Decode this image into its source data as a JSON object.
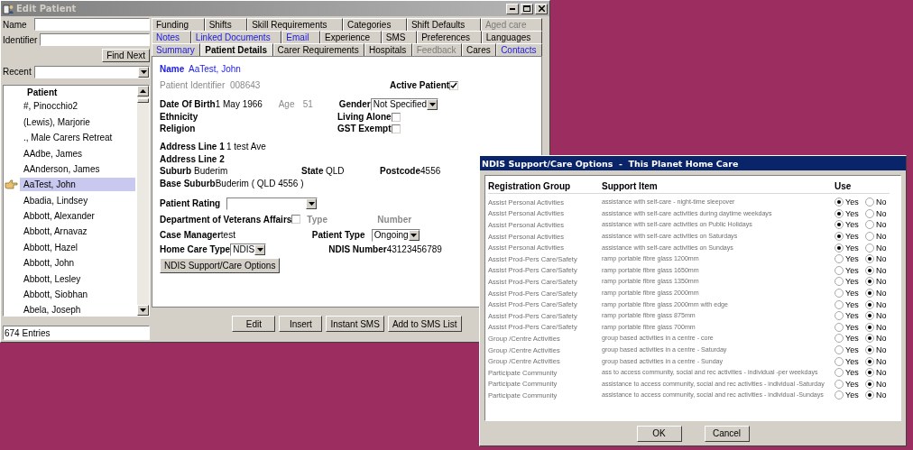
{
  "main_window": {
    "title": "Edit Patient"
  },
  "search": {
    "name_label": "Name",
    "identifier_label": "Identifier",
    "find_button": "Find Next",
    "recent_label": "Recent"
  },
  "patients": {
    "header": "Patient",
    "items": [
      {
        "name": "#, Pinocchio2",
        "selected": false
      },
      {
        "name": "(Lewis), Marjorie",
        "selected": false
      },
      {
        "name": "., Male Carers Retreat",
        "selected": false
      },
      {
        "name": "AAdbe, James",
        "selected": false
      },
      {
        "name": "AAnderson, James",
        "selected": false
      },
      {
        "name": "AaTest, John",
        "selected": true
      },
      {
        "name": "Abadia, Lindsey",
        "selected": false
      },
      {
        "name": "Abbott, Alexander",
        "selected": false
      },
      {
        "name": "Abbott, Arnavaz",
        "selected": false
      },
      {
        "name": "Abbott, Hazel",
        "selected": false
      },
      {
        "name": "Abbott, John",
        "selected": false
      },
      {
        "name": "Abbott, Lesley",
        "selected": false
      },
      {
        "name": "Abbott, Siobhan",
        "selected": false
      },
      {
        "name": "Abela, Joseph",
        "selected": false
      }
    ],
    "entries": "674 Entries"
  },
  "tab_rows": [
    {
      "tabs": [
        {
          "label": "Funding",
          "selected": false,
          "disabled": false,
          "highlighted": false
        },
        {
          "label": "Shifts",
          "selected": false,
          "disabled": false,
          "highlighted": false
        },
        {
          "label": "Skill Requirements",
          "selected": false,
          "disabled": false,
          "highlighted": false
        },
        {
          "label": "Categories",
          "selected": false,
          "disabled": false,
          "highlighted": false
        },
        {
          "label": "Shift Defaults",
          "selected": false,
          "disabled": false,
          "highlighted": false
        },
        {
          "label": "Aged care",
          "selected": false,
          "disabled": true,
          "highlighted": false
        }
      ]
    },
    {
      "tabs": [
        {
          "label": "Notes",
          "selected": false,
          "disabled": false,
          "highlighted": true
        },
        {
          "label": "Linked Documents",
          "selected": false,
          "disabled": false,
          "highlighted": true
        },
        {
          "label": "Email",
          "selected": false,
          "disabled": false,
          "highlighted": true
        },
        {
          "label": "Experience",
          "selected": false,
          "disabled": false,
          "highlighted": false
        },
        {
          "label": "SMS",
          "selected": false,
          "disabled": false,
          "highlighted": false
        },
        {
          "label": "Preferences",
          "selected": false,
          "disabled": false,
          "highlighted": false
        },
        {
          "label": "Languages",
          "selected": false,
          "disabled": false,
          "highlighted": false
        }
      ]
    },
    {
      "tabs": [
        {
          "label": "Summary",
          "selected": false,
          "disabled": false,
          "highlighted": true
        },
        {
          "label": "Patient Details",
          "selected": true,
          "disabled": false,
          "highlighted": false
        },
        {
          "label": "Carer Requirements",
          "selected": false,
          "disabled": false,
          "highlighted": false
        },
        {
          "label": "Hospitals",
          "selected": false,
          "disabled": false,
          "highlighted": false
        },
        {
          "label": "Feedback",
          "selected": false,
          "disabled": true,
          "highlighted": false
        },
        {
          "label": "Cares",
          "selected": false,
          "disabled": false,
          "highlighted": false
        },
        {
          "label": "Contacts",
          "selected": false,
          "disabled": false,
          "highlighted": true
        }
      ]
    }
  ],
  "details": {
    "name_label": "Name",
    "name": "AaTest, John",
    "identifier_label": "Patient Identifier",
    "identifier": "008643",
    "active_label": "Active Patient",
    "active": true,
    "dob_label": "Date Of Birth",
    "dob": "1 May 1966",
    "age_label": "Age",
    "age": "51",
    "gender_label": "Gender",
    "gender": "Not Specified",
    "ethnicity_label": "Ethnicity",
    "living_alone_label": "Living Alone",
    "living_alone": false,
    "religion_label": "Religion",
    "gst_label": "GST Exempt",
    "gst_exempt": false,
    "address1_label": "Address Line 1",
    "address1": "1 test Ave",
    "address2_label": "Address Line 2",
    "suburb_label": "Suburb",
    "suburb": "Buderim",
    "state_label": "State",
    "state": "QLD",
    "postcode_label": "Postcode",
    "postcode": "4556",
    "base_suburb_label": "Base Suburb",
    "base_suburb": "Buderim ( QLD 4556 )",
    "rating_label": "Patient Rating",
    "dva_label": "Department of Veterans Affairs",
    "dva": false,
    "type_label": "Type",
    "number_label": "Number",
    "case_manager_label": "Case Manager",
    "case_manager": "test",
    "patient_type_label": "Patient Type",
    "patient_type": "Ongoing",
    "home_care_label": "Home Care Type",
    "home_care": "NDIS",
    "ndis_number_label": "NDIS Number",
    "ndis_number": "43123456789",
    "options_button": "NDIS Support/Care Options"
  },
  "actions": [
    "Edit",
    "Insert",
    "Instant SMS",
    "Add to SMS List"
  ],
  "dialog": {
    "title": "NDIS Support/Care Options  -  This Planet Home Care",
    "columns": [
      "Registration Group",
      "Support Item",
      "Use"
    ],
    "rows": [
      {
        "group": "Assist Personal Activities",
        "item": "assistance with self-care - night-time sleepover",
        "options": [
          {
            "label": "Yes",
            "selected": true
          },
          {
            "label": "No",
            "selected": false
          }
        ]
      },
      {
        "group": "Assist Personal Activities",
        "item": "assistance with self-care activities during daytime weekdays",
        "options": [
          {
            "label": "Yes",
            "selected": true
          },
          {
            "label": "No",
            "selected": false
          }
        ]
      },
      {
        "group": "Assist Personal Activities",
        "item": "assistance with self-care activities on Public Holidays",
        "options": [
          {
            "label": "Yes",
            "selected": true
          },
          {
            "label": "No",
            "selected": false
          }
        ]
      },
      {
        "group": "Assist Personal Activities",
        "item": "assistance with self-care activities on Saturdays",
        "options": [
          {
            "label": "Yes",
            "selected": true
          },
          {
            "label": "No",
            "selected": false
          }
        ]
      },
      {
        "group": "Assist Personal Activities",
        "item": "assistance with self-care activities on Sundays",
        "options": [
          {
            "label": "Yes",
            "selected": true
          },
          {
            "label": "No",
            "selected": false
          }
        ]
      },
      {
        "group": "Assist Prod-Pers Care/Safety",
        "item": "ramp portable fibre glass 1200mm",
        "options": [
          {
            "label": "Yes",
            "selected": false
          },
          {
            "label": "No",
            "selected": true
          }
        ]
      },
      {
        "group": "Assist Prod-Pers Care/Safety",
        "item": "ramp portable fibre glass 1650mm",
        "options": [
          {
            "label": "Yes",
            "selected": false
          },
          {
            "label": "No",
            "selected": true
          }
        ]
      },
      {
        "group": "Assist Prod-Pers Care/Safety",
        "item": "ramp portable fibre glass 1350mm",
        "options": [
          {
            "label": "Yes",
            "selected": false
          },
          {
            "label": "No",
            "selected": true
          }
        ]
      },
      {
        "group": "Assist Prod-Pers Care/Safety",
        "item": "ramp portable fibre glass 2000mm",
        "options": [
          {
            "label": "Yes",
            "selected": false
          },
          {
            "label": "No",
            "selected": true
          }
        ]
      },
      {
        "group": "Assist Prod-Pers Care/Safety",
        "item": "ramp portable fibre glass 2000mm with edge",
        "options": [
          {
            "label": "Yes",
            "selected": false
          },
          {
            "label": "No",
            "selected": true
          }
        ]
      },
      {
        "group": "Assist Prod-Pers Care/Safety",
        "item": "ramp portable fibre glass 875mm",
        "options": [
          {
            "label": "Yes",
            "selected": false
          },
          {
            "label": "No",
            "selected": true
          }
        ]
      },
      {
        "group": "Assist Prod-Pers Care/Safety",
        "item": "ramp portable fibre glass 700mm",
        "options": [
          {
            "label": "Yes",
            "selected": false
          },
          {
            "label": "No",
            "selected": true
          }
        ]
      },
      {
        "group": "Group /Centre Activities",
        "item": "group based activities in a centre - core",
        "options": [
          {
            "label": "Yes",
            "selected": false
          },
          {
            "label": "No",
            "selected": true
          }
        ]
      },
      {
        "group": "Group /Centre Activities",
        "item": "group based activities in a centre - Saturday",
        "options": [
          {
            "label": "Yes",
            "selected": false
          },
          {
            "label": "No",
            "selected": true
          }
        ]
      },
      {
        "group": "Group /Centre Activities",
        "item": "group based activities in a centre - Sunday",
        "options": [
          {
            "label": "Yes",
            "selected": false
          },
          {
            "label": "No",
            "selected": true
          }
        ]
      },
      {
        "group": "Participate Community",
        "item": "ass to access community, social and rec activities - individual -per weekdays",
        "options": [
          {
            "label": "Yes",
            "selected": false
          },
          {
            "label": "No",
            "selected": true
          }
        ]
      },
      {
        "group": "Participate Community",
        "item": "assistance to access community, social and rec activities - individual -Saturday",
        "options": [
          {
            "label": "Yes",
            "selected": false
          },
          {
            "label": "No",
            "selected": true
          }
        ]
      },
      {
        "group": "Participate Community",
        "item": "assistance to access community, social and rec activities - individual -Sundays",
        "options": [
          {
            "label": "Yes",
            "selected": false
          },
          {
            "label": "No",
            "selected": true
          }
        ]
      }
    ],
    "buttons": [
      "OK",
      "Cancel"
    ]
  }
}
